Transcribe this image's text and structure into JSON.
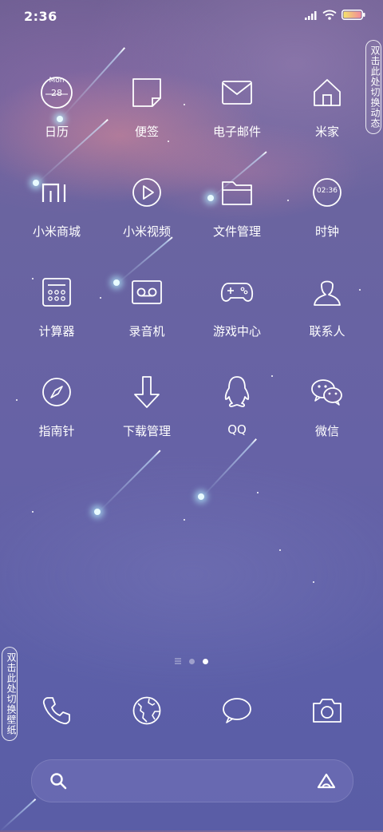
{
  "status_bar": {
    "time": "2:36"
  },
  "side_tabs": {
    "top": "双击此处切换动态",
    "bottom": "双击此处切换壁纸"
  },
  "calendar_icon": {
    "day_name": "Mon",
    "day_number": "28"
  },
  "clock_icon": {
    "time": "02:36"
  },
  "apps": [
    {
      "label": "日历",
      "icon": "calendar-icon"
    },
    {
      "label": "便签",
      "icon": "note-icon"
    },
    {
      "label": "电子邮件",
      "icon": "mail-icon"
    },
    {
      "label": "米家",
      "icon": "home-icon"
    },
    {
      "label": "小米商城",
      "icon": "mi-logo-icon"
    },
    {
      "label": "小米视频",
      "icon": "play-icon"
    },
    {
      "label": "文件管理",
      "icon": "folder-icon"
    },
    {
      "label": "时钟",
      "icon": "clock-icon"
    },
    {
      "label": "计算器",
      "icon": "calculator-icon"
    },
    {
      "label": "录音机",
      "icon": "recorder-icon"
    },
    {
      "label": "游戏中心",
      "icon": "gamepad-icon"
    },
    {
      "label": "联系人",
      "icon": "contact-icon"
    },
    {
      "label": "指南针",
      "icon": "compass-icon"
    },
    {
      "label": "下载管理",
      "icon": "download-icon"
    },
    {
      "label": "QQ",
      "icon": "qq-penguin-icon"
    },
    {
      "label": "微信",
      "icon": "wechat-icon"
    }
  ],
  "dock": [
    {
      "icon": "phone-icon"
    },
    {
      "icon": "browser-icon"
    },
    {
      "icon": "message-icon"
    },
    {
      "icon": "camera-icon"
    }
  ],
  "page_indicator": {
    "pages": 2,
    "current": 2
  },
  "search_bar": {
    "icons": [
      "search-icon",
      "assistant-icon"
    ]
  }
}
